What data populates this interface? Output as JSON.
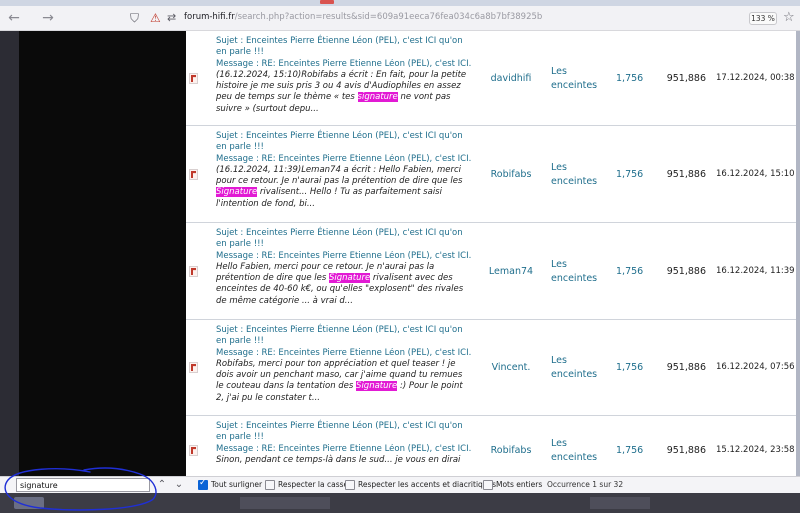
{
  "browser": {
    "url_host": "forum-hifi.fr",
    "url_path": "/search.php?action=results&sid=609a91eeca76fea034c6a8b7bf38925b",
    "zoom": "133 %",
    "back_icon": "arrow-left-icon",
    "forward_icon": "arrow-right-icon"
  },
  "results": [
    {
      "subject": "Sujet : Enceintes Pierre Étienne Léon (PEL), c'est ICI qu'on en parle !!!",
      "message": "Message : RE: Enceintes Pierre Étienne Léon (PEL), c'est ICI...",
      "excerpt_before": "(16.12.2024, 15:10)Robifabs a écrit : En fait, pour la petite histoire je me suis pris 3 ou 4 avis d'Audiophiles en assez peu de temps sur le thème « tes ",
      "excerpt_hl": "signature",
      "excerpt_after": " ne vont pas suivre » (surtout depu...",
      "author": "davidhifi",
      "forum": "Les enceintes",
      "replies": "1,756",
      "views": "951,886",
      "date": "17.12.2024, 00:38"
    },
    {
      "subject": "Sujet : Enceintes Pierre Étienne Léon (PEL), c'est ICI qu'on en parle !!!",
      "message": "Message : RE: Enceintes Pierre Étienne Léon (PEL), c'est ICI...",
      "excerpt_before": "(16.12.2024, 11:39)Leman74 a écrit : Hello Fabien, merci pour ce retour. Je n'aurai pas la prétention de dire que les ",
      "excerpt_hl": "Signature",
      "excerpt_after": " rivalisent... Hello ! Tu as parfaitement saisi l'intention de fond, bi...",
      "author": "Robifabs",
      "forum": "Les enceintes",
      "replies": "1,756",
      "views": "951,886",
      "date": "16.12.2024, 15:10"
    },
    {
      "subject": "Sujet : Enceintes Pierre Étienne Léon (PEL), c'est ICI qu'on en parle !!!",
      "message": "Message : RE: Enceintes Pierre Étienne Léon (PEL), c'est ICI...",
      "excerpt_before": "Hello Fabien, merci pour ce retour. Je n'aurai pas la prétention de dire que les ",
      "excerpt_hl": "Signature",
      "excerpt_after": " rivalisent avec des enceintes de 40-60 k€, ou qu'elles \"explosent\" des rivales de même catégorie ... à vrai d...",
      "author": "Leman74",
      "forum": "Les enceintes",
      "replies": "1,756",
      "views": "951,886",
      "date": "16.12.2024, 11:39"
    },
    {
      "subject": "Sujet : Enceintes Pierre Étienne Léon (PEL), c'est ICI qu'on en parle !!!",
      "message": "Message : RE: Enceintes Pierre Étienne Léon (PEL), c'est ICI...",
      "excerpt_before": "Robifabs, merci pour ton appréciation et quel teaser ! je dois avoir un penchant maso, car j'aime quand tu remues le couteau dans la tentation des ",
      "excerpt_hl": "Signature",
      "excerpt_after": " :) Pour le point 2, j'ai pu le constater t...",
      "author": "Vincent.",
      "forum": "Les enceintes",
      "replies": "1,756",
      "views": "951,886",
      "date": "16.12.2024, 07:56"
    },
    {
      "subject": "Sujet : Enceintes Pierre Étienne Léon (PEL), c'est ICI qu'on en parle !!!",
      "message": "Message : RE: Enceintes Pierre Étienne Léon (PEL), c'est ICI...",
      "excerpt_before": "Sinon, pendant ce temps-là dans le sud... je vous en dirai",
      "excerpt_hl": "",
      "excerpt_after": "",
      "author": "Robifabs",
      "forum": "Les enceintes",
      "replies": "1,756",
      "views": "951,886",
      "date": "15.12.2024, 23:58"
    }
  ],
  "findbar": {
    "query": "signature",
    "highlight_all": "Tout surligner",
    "match_case": "Respecter la casse",
    "match_diacritics": "Respecter les accents et diacritiques",
    "whole_words": "Mots entiers",
    "status": "Occurrence 1 sur 32",
    "highlight_all_checked": true
  },
  "colors": {
    "link": "#1f6e8c",
    "highlight": "#e21ad4",
    "annotation": "#1f2fd6"
  }
}
